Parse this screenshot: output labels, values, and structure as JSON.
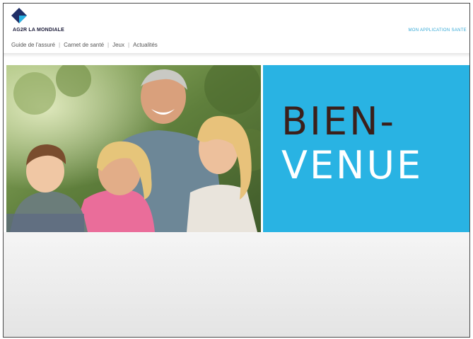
{
  "brand": {
    "name": "AG2R LA MONDIALE",
    "logo_colors": [
      "#1f2e66",
      "#29b3e3",
      "#1c1c3a"
    ]
  },
  "header": {
    "top_link": "MON APPLICATION SANTE"
  },
  "nav": {
    "items": [
      {
        "label": "Guide de l'assuré"
      },
      {
        "label": "Carnet de santé"
      },
      {
        "label": "Jeux"
      },
      {
        "label": "Actualités"
      }
    ]
  },
  "hero": {
    "line1": "BIEN-",
    "line2": "VENUE",
    "panel_color": "#29b3e3",
    "line1_color": "#3b1f1a",
    "line2_color": "#ffffff"
  }
}
